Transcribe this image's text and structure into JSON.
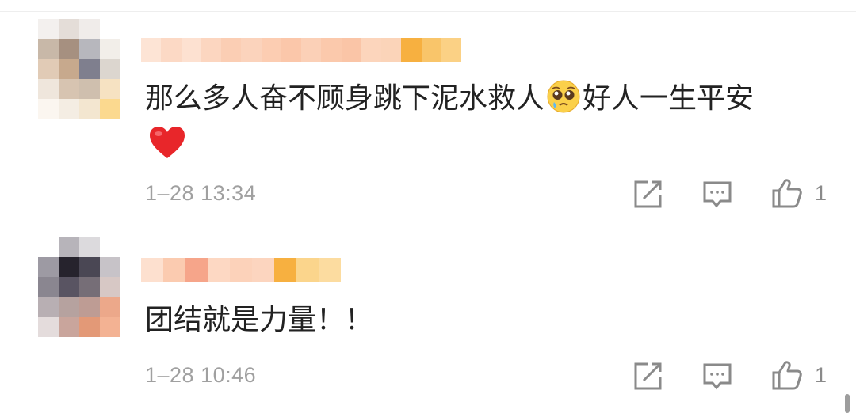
{
  "comments": [
    {
      "text": "那么多人奋不顾身跳下泥水救人",
      "text_after_emoji": "好人一生平安",
      "inline_emoji": "pleading-face-emoji",
      "trailing_emoji": "red-heart-emoji",
      "time": "1–28 13:34",
      "like_count": "1"
    },
    {
      "text": "团结就是力量！！",
      "time": "1–28 10:46",
      "like_count": "1"
    }
  ],
  "icons": {
    "share": "share-icon",
    "reply": "comment-icon",
    "like": "thumbs-up-icon"
  },
  "colors": {
    "text": "#222222",
    "meta": "#a0a0a0",
    "icon": "#8a8a8a",
    "heart": "#e8262a",
    "name_blur": "#f6a55f"
  }
}
